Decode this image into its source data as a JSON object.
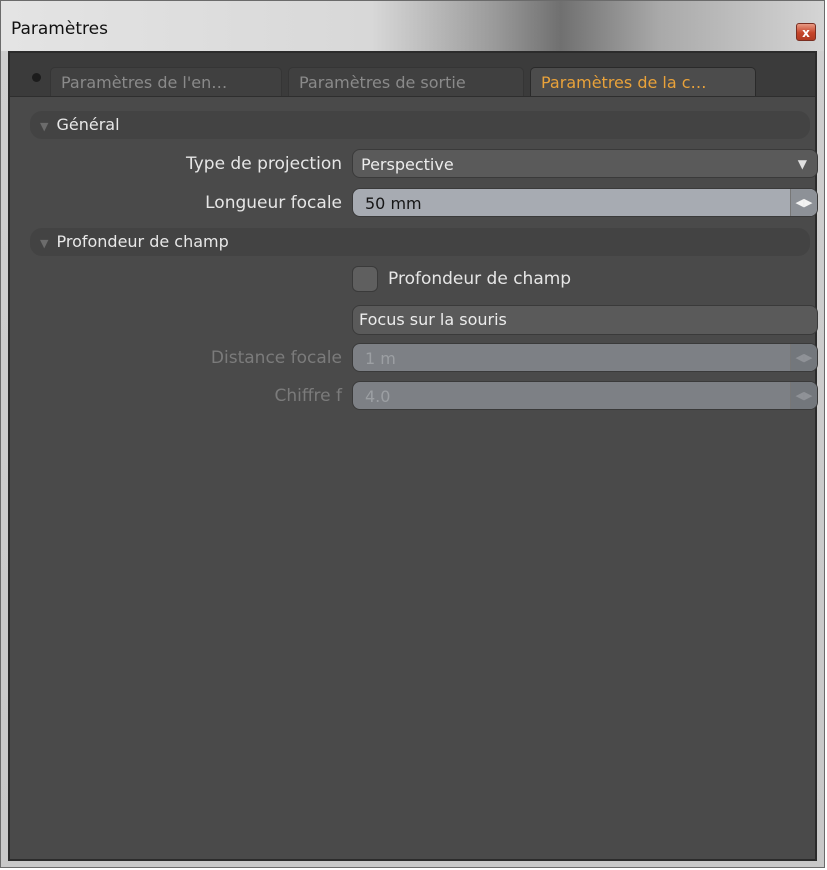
{
  "window": {
    "title": "Paramètres",
    "close_label": "x"
  },
  "tabs": [
    {
      "label": "Paramètres de l'en…",
      "active": false
    },
    {
      "label": "Paramètres de sortie",
      "active": false
    },
    {
      "label": "Paramètres de la c…",
      "active": true
    }
  ],
  "sections": {
    "general": {
      "title": "Général",
      "projection_label": "Type de projection",
      "projection_value": "Perspective",
      "focal_length_label": "Longueur focale",
      "focal_length_value": "50 mm"
    },
    "depth_of_field": {
      "title": "Profondeur de champ",
      "checkbox_label": "Profondeur de champ",
      "checkbox_checked": false,
      "focus_button_label": "Focus sur la souris",
      "focal_distance_label": "Distance focale",
      "focal_distance_value": "1 m",
      "fstop_label": "Chiffre f",
      "fstop_value": "4.0"
    }
  },
  "colors": {
    "active_tab": "#e9a23a",
    "panel_bg": "#4a4a4a",
    "field_bg": "#a7abb2"
  }
}
